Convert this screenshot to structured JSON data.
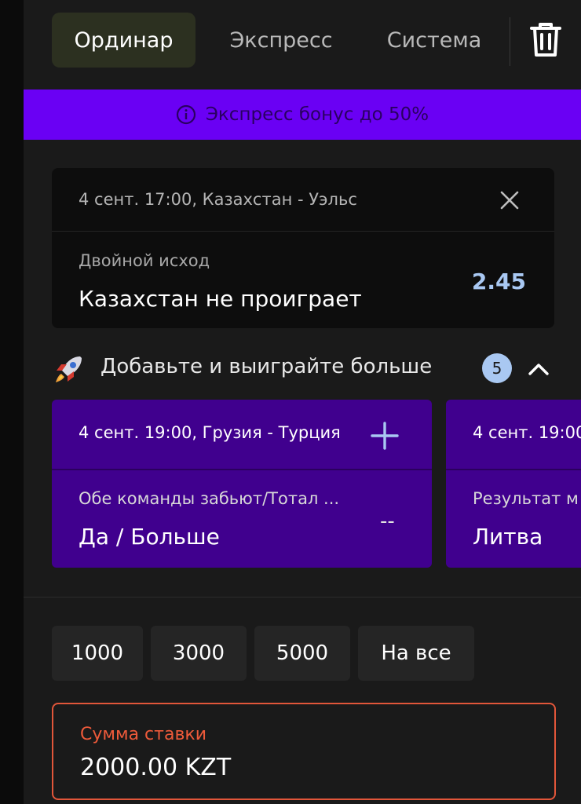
{
  "tabs": [
    {
      "label": "Ординар",
      "active": true
    },
    {
      "label": "Экспресс",
      "active": false
    },
    {
      "label": "Система",
      "active": false
    }
  ],
  "toolbar": {
    "trash_icon": "trash-icon"
  },
  "bonus_banner": {
    "text": "Экспресс бонус до 50%",
    "icon": "info-icon",
    "color": "#6a00f4"
  },
  "bet": {
    "event": "4 сент. 17:00, Казахстан - Уэльс",
    "market": "Двойной исход",
    "outcome": "Казахстан не проиграет",
    "odds": "2.45",
    "close_icon": "close-icon"
  },
  "suggestions": {
    "icon": "rocket-icon",
    "title": "Добавьте и выиграйте больше",
    "count": "5",
    "items": [
      {
        "event": "4 сент. 19:00, Грузия - Турция",
        "market": "Обе команды забьют/Тотал ...",
        "outcome": "Да / Больше",
        "odds": "--"
      },
      {
        "event": "4 сент. 19:00",
        "market": "Результат м",
        "outcome": "Литва",
        "odds": ""
      }
    ]
  },
  "quick_amounts": [
    "1000",
    "3000",
    "5000",
    "На все"
  ],
  "stake": {
    "label": "Сумма ставки",
    "value": "2000.00 KZT"
  },
  "colors": {
    "accent_purple": "#6a00f4",
    "card_purple": "#40008e",
    "odds_blue": "#a9c8f2",
    "error_orange": "#e2563a"
  }
}
